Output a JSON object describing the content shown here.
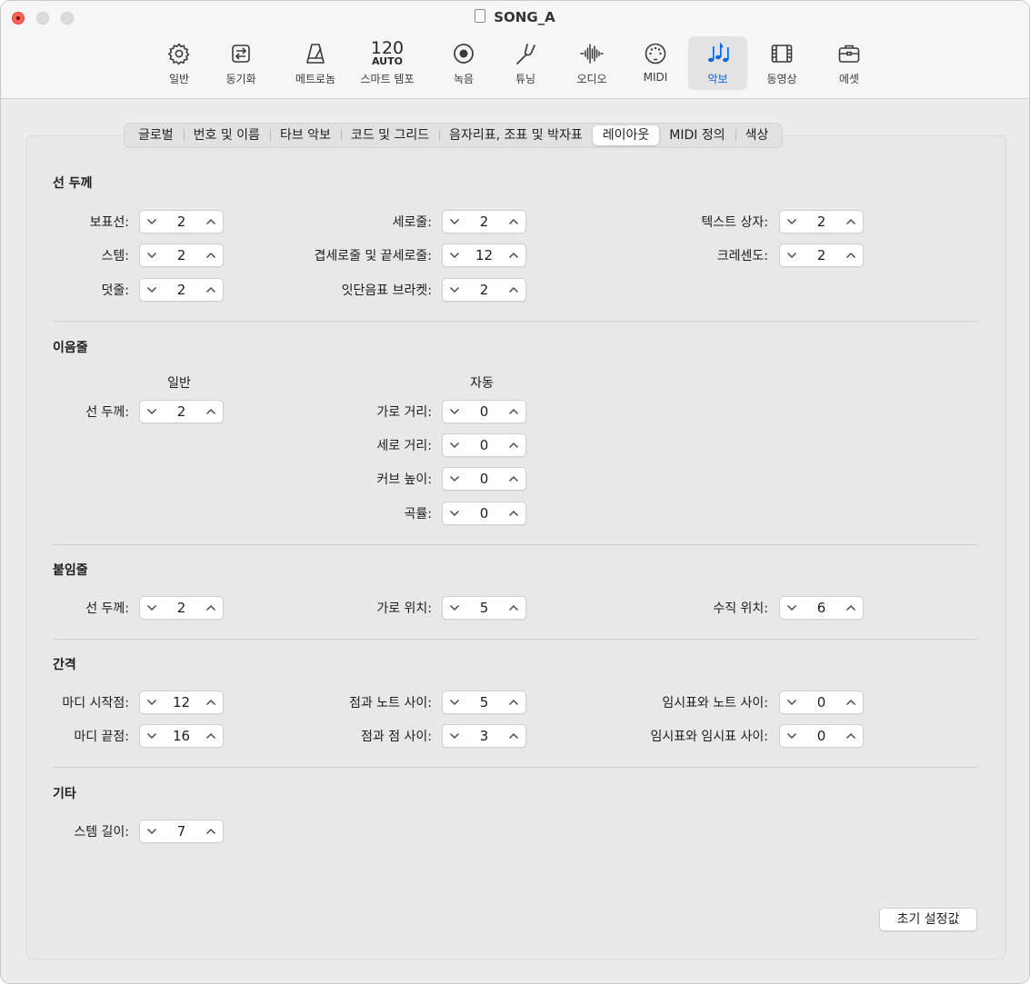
{
  "window": {
    "title": "SONG_A"
  },
  "toolbar": {
    "tempo_number": "120",
    "tempo_auto": "AUTO",
    "items": [
      {
        "label": "일반",
        "icon": "gear-icon"
      },
      {
        "label": "동기화",
        "icon": "sync-icon"
      },
      {
        "label": "메트로놈",
        "icon": "metronome-icon"
      },
      {
        "label": "스마트 템포",
        "icon": "smart-tempo-icon"
      },
      {
        "label": "녹음",
        "icon": "record-icon"
      },
      {
        "label": "튜닝",
        "icon": "tuning-fork-icon"
      },
      {
        "label": "오디오",
        "icon": "audio-waveform-icon"
      },
      {
        "label": "MIDI",
        "icon": "midi-port-icon"
      },
      {
        "label": "악보",
        "icon": "music-notes-icon"
      },
      {
        "label": "동영상",
        "icon": "film-icon"
      },
      {
        "label": "에셋",
        "icon": "briefcase-icon"
      }
    ],
    "active_color": "#0a64e0"
  },
  "tabs": [
    "글로벌",
    "번호 및 이름",
    "타브 악보",
    "코드 및 그리드",
    "음자리표, 조표 및 박자표",
    "레이아웃",
    "MIDI 정의",
    "색상"
  ],
  "sections": {
    "line_thickness": {
      "title": "선 두께",
      "staff": {
        "label": "보표선:",
        "value": "2"
      },
      "stem": {
        "label": "스템:",
        "value": "2"
      },
      "ledger": {
        "label": "덧줄:",
        "value": "2"
      },
      "barline": {
        "label": "세로줄:",
        "value": "2"
      },
      "double_barline": {
        "label": "겹세로줄 및 끝세로줄:",
        "value": "12"
      },
      "tuplet_bracket": {
        "label": "잇단음표 브라켓:",
        "value": "2"
      },
      "text_box": {
        "label": "텍스트 상자:",
        "value": "2"
      },
      "crescendo": {
        "label": "크레센도:",
        "value": "2"
      }
    },
    "slur": {
      "title": "이음줄",
      "general_heading": "일반",
      "auto_heading": "자동",
      "thickness": {
        "label": "선 두께:",
        "value": "2"
      },
      "h_distance": {
        "label": "가로 거리:",
        "value": "0"
      },
      "v_distance": {
        "label": "세로 거리:",
        "value": "0"
      },
      "curve_height": {
        "label": "커브 높이:",
        "value": "0"
      },
      "curvature": {
        "label": "곡률:",
        "value": "0"
      }
    },
    "tie": {
      "title": "붙임줄",
      "thickness": {
        "label": "선 두께:",
        "value": "2"
      },
      "h_position": {
        "label": "가로 위치:",
        "value": "5"
      },
      "v_position": {
        "label": "수직 위치:",
        "value": "6"
      }
    },
    "spacing": {
      "title": "간격",
      "bar_start": {
        "label": "마디 시작점:",
        "value": "12"
      },
      "bar_end": {
        "label": "마디 끝점:",
        "value": "16"
      },
      "dot_note": {
        "label": "점과 노트 사이:",
        "value": "5"
      },
      "dot_dot": {
        "label": "점과 점 사이:",
        "value": "3"
      },
      "accidental_note": {
        "label": "임시표와 노트 사이:",
        "value": "0"
      },
      "accidental_accidental": {
        "label": "임시표와 임시표 사이:",
        "value": "0"
      }
    },
    "other": {
      "title": "기타",
      "stem_length": {
        "label": "스템 길이:",
        "value": "7"
      }
    }
  },
  "reset_button": "초기 설정값"
}
